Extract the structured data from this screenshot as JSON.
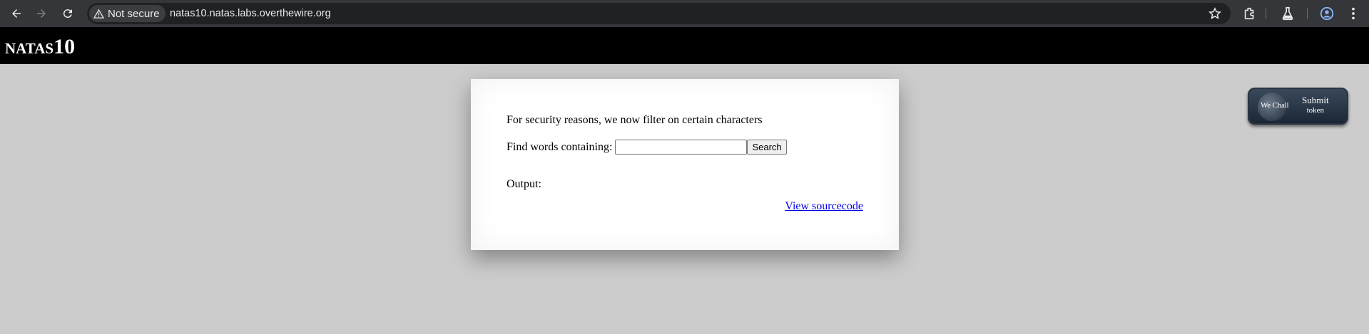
{
  "browser": {
    "security_label": "Not secure",
    "url": "natas10.natas.labs.overthewire.org"
  },
  "header": {
    "title_small": "NATAS",
    "title_big": "10"
  },
  "content": {
    "message": "For security reasons, we now filter on certain characters",
    "find_label": "Find words containing:",
    "search_value": "",
    "search_button": "Search",
    "output_label": "Output:",
    "view_source_link": "View sourcecode"
  },
  "submit_token": {
    "badge_text": "We Chall",
    "line1": "Submit",
    "line2": "token"
  },
  "colors": {
    "page_bg": "#cccccc",
    "header_bg": "#000000",
    "link": "#0000ee",
    "chrome_bg": "#35363a"
  }
}
